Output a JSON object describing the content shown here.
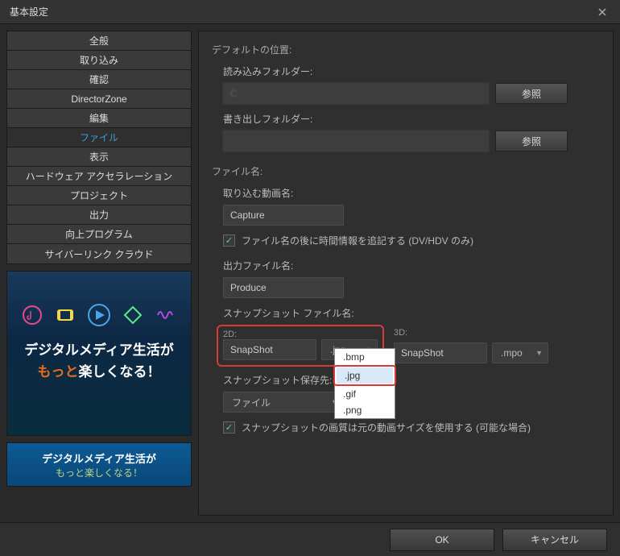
{
  "titlebar": {
    "title": "基本設定"
  },
  "sidebar": {
    "items": [
      {
        "label": "全般"
      },
      {
        "label": "取り込み"
      },
      {
        "label": "確認"
      },
      {
        "label": "DirectorZone"
      },
      {
        "label": "編集"
      },
      {
        "label": "ファイル"
      },
      {
        "label": "表示"
      },
      {
        "label": "ハードウェア アクセラレーション"
      },
      {
        "label": "プロジェクト"
      },
      {
        "label": "出力"
      },
      {
        "label": "向上プログラム"
      },
      {
        "label": "サイバーリンク クラウド"
      }
    ],
    "active_index": 5
  },
  "promo": {
    "line1": "デジタルメディア生活が",
    "line2a": "もっと",
    "line2b": "楽しくなる！"
  },
  "promo2": {
    "line1": "デジタルメディア生活が",
    "line2": "もっと楽しくなる！"
  },
  "main": {
    "default_location": {
      "title": "デフォルトの位置:",
      "import_label": "読み込みフォルダー:",
      "import_value": "C",
      "export_label": "書き出しフォルダー:",
      "export_value": "",
      "browse": "参照"
    },
    "filename": {
      "title": "ファイル名:",
      "import_label": "取り込む動画名:",
      "import_value": "Capture",
      "append_time": "ファイル名の後に時間情報を追記する (DV/HDV のみ)",
      "output_label": "出力ファイル名:",
      "output_value": "Produce"
    },
    "snapshot": {
      "title": "スナップショット ファイル名:",
      "label_2d": "2D:",
      "value_2d": "SnapShot",
      "format_2d": ".jpg",
      "label_3d": "3D:",
      "value_3d": "SnapShot",
      "format_3d": ".mpo",
      "dest_label": "スナップショット保存先:",
      "dest_value": "ファイル",
      "quality": "スナップショットの画質は元の動画サイズを使用する (可能な場合)"
    },
    "dropdown_options": [
      ".bmp",
      ".jpg",
      ".gif",
      ".png"
    ]
  },
  "footer": {
    "ok": "OK",
    "cancel": "キャンセル"
  }
}
